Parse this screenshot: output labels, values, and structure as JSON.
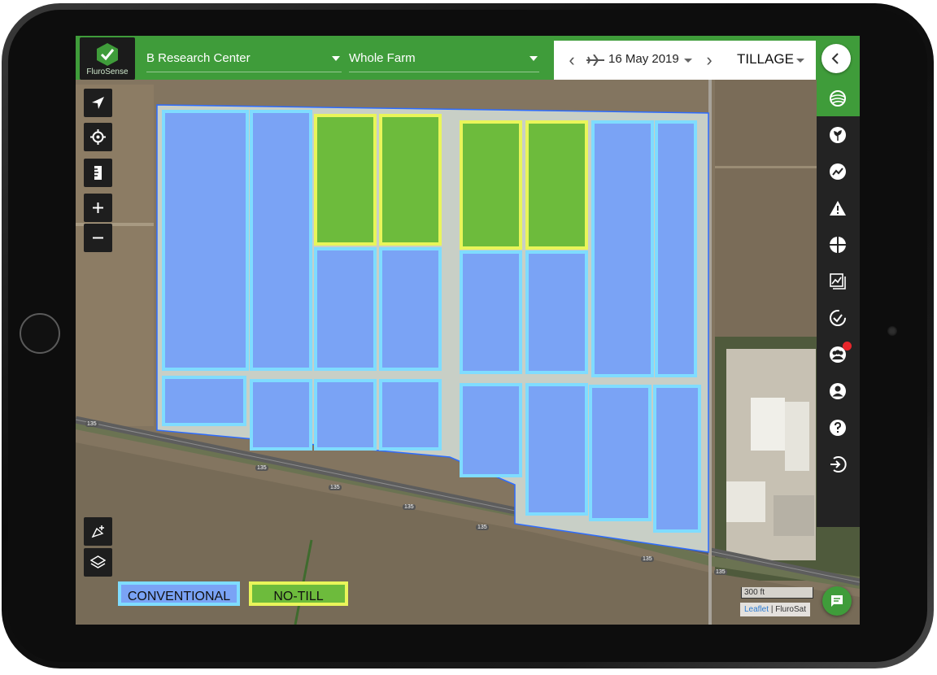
{
  "app": {
    "logo_text": "FluroSense"
  },
  "header": {
    "farm_select": "B Research Center",
    "field_select": "Whole Farm",
    "date": "16 May 2019",
    "layer": "TILLAGE"
  },
  "sidebar": {
    "icons": [
      "fields-icon",
      "crop-icon",
      "analytics-icon",
      "alert-icon",
      "zoning-icon",
      "reports-icon",
      "check-icon",
      "team-icon",
      "account-icon",
      "help-icon",
      "logout-icon"
    ],
    "notification_badge": true
  },
  "map_controls": [
    "locate-icon",
    "crosshair-icon",
    "ruler-icon",
    "zoom-in-icon",
    "zoom-out-icon"
  ],
  "legend": [
    {
      "label": "CONVENTIONAL",
      "color": "#7aa3f5",
      "border": "#7fdcff"
    },
    {
      "label": "NO-TILL",
      "color": "#6dbb3c",
      "border": "#e9f55a"
    }
  ],
  "scale_label": "300 ft",
  "attribution": {
    "link": "Leaflet",
    "separator": "|",
    "source": "FluroSat"
  },
  "road_markers": [
    "135",
    "135",
    "135",
    "135",
    "135",
    "135",
    "135"
  ],
  "colors": {
    "brand": "#3f9c3a",
    "sidebar": "#232323",
    "conventional": "#7aa3f5",
    "no_till": "#6dbb3c"
  }
}
